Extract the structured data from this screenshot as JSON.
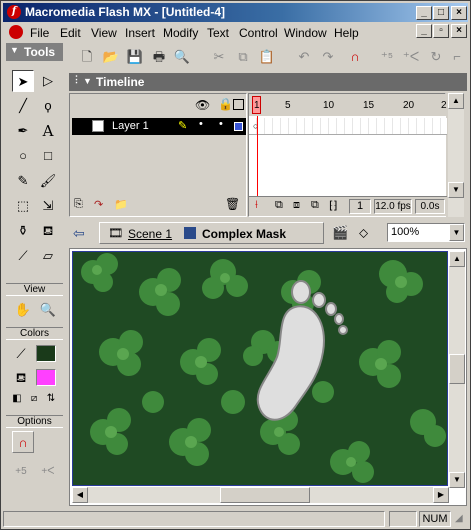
{
  "window": {
    "title": "Macromedia Flash MX - [Untitled-4]",
    "app_icon_glyph": "f"
  },
  "menu": [
    "File",
    "Edit",
    "View",
    "Insert",
    "Modify",
    "Text",
    "Control",
    "Window",
    "Help"
  ],
  "tools": {
    "header": "Tools",
    "view_label": "View",
    "colors_label": "Colors",
    "options_label": "Options",
    "stroke_color": "#1a3a1a",
    "fill_color": "#ff40ff"
  },
  "timeline": {
    "label": "Timeline",
    "layer_name": "Layer 1",
    "frame_numbers": [
      "1",
      "5",
      "10",
      "15",
      "20",
      "2"
    ],
    "current_frame": "1",
    "fps": "12.0 fps",
    "time": "0.0s"
  },
  "scene": {
    "scene_name": "Scene 1",
    "symbol_name": "Complex Mask",
    "zoom": "100%"
  },
  "status": {
    "num": "NUM"
  },
  "colors": {
    "title_start": "#0a246a",
    "title_end": "#a6caf0",
    "layer_row": "#000000",
    "playhead": "#ff0000",
    "layer_color_box": "#3a56d6"
  }
}
